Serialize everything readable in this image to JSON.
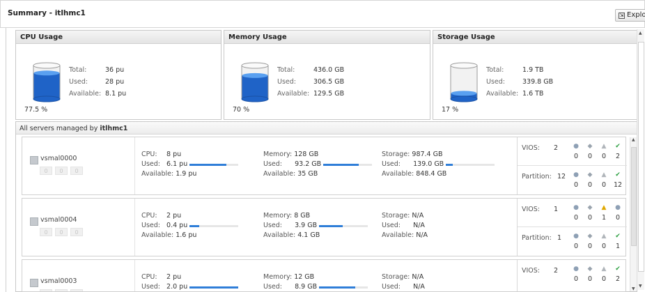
{
  "header": {
    "title": "Summary - itlhmc1",
    "explore_label": "Explore"
  },
  "usage": {
    "cpu": {
      "title": "CPU Usage",
      "total_label": "Total:",
      "total": "36 pu",
      "used_label": "Used:",
      "used": "28 pu",
      "avail_label": "Available:",
      "available": "8.1 pu",
      "percent": "77.5 %",
      "fill_fraction": 0.775
    },
    "memory": {
      "title": "Memory Usage",
      "total_label": "Total:",
      "total": "436.0 GB",
      "used_label": "Used:",
      "used": "306.5 GB",
      "avail_label": "Available:",
      "available": "129.5 GB",
      "percent": "70 %",
      "fill_fraction": 0.7
    },
    "storage": {
      "title": "Storage Usage",
      "total_label": "Total:",
      "total": "1.9 TB",
      "used_label": "Used:",
      "used": "339.8 GB",
      "avail_label": "Available:",
      "available": "1.6 TB",
      "percent": "17 %",
      "fill_fraction": 0.17
    }
  },
  "servers": {
    "header_prefix": "All servers managed by",
    "header_host": "itlhmc1",
    "rows": [
      {
        "name": "vsmal0000",
        "badges": [
          "0",
          "0",
          "0"
        ],
        "cpu_label": "CPU:",
        "cpu": "8 pu",
        "cpu_used_label": "Used:",
        "cpu_used": "6.1 pu",
        "cpu_used_fraction": 0.76,
        "cpu_avail_label": "Available:",
        "cpu_avail": "1.9 pu",
        "mem_label": "Memory:",
        "mem": "128 GB",
        "mem_used_label": "Used:",
        "mem_used": "93.2 GB",
        "mem_used_fraction": 0.73,
        "mem_avail_label": "Available:",
        "mem_avail": "35 GB",
        "sto_label": "Storage:",
        "sto": "987.4 GB",
        "sto_used_label": "Used:",
        "sto_used": "139.0 GB",
        "sto_used_fraction": 0.14,
        "sto_avail_label": "Available:",
        "sto_avail": "848.4 GB",
        "vios_label": "VIOS:",
        "vios_total": "2",
        "vios_counts": [
          "0",
          "0",
          "0",
          "2"
        ],
        "part_label": "Partition:",
        "part_total": "12",
        "part_counts": [
          "0",
          "0",
          "0",
          "12"
        ]
      },
      {
        "name": "vsmal0004",
        "badges": [
          "0",
          "0",
          "0"
        ],
        "cpu_label": "CPU:",
        "cpu": "2 pu",
        "cpu_used_label": "Used:",
        "cpu_used": "0.4 pu",
        "cpu_used_fraction": 0.2,
        "cpu_avail_label": "Available:",
        "cpu_avail": "1.6 pu",
        "mem_label": "Memory:",
        "mem": "8 GB",
        "mem_used_label": "Used:",
        "mem_used": "3.9 GB",
        "mem_used_fraction": 0.49,
        "mem_avail_label": "Available:",
        "mem_avail": "4.1 GB",
        "sto_label": "Storage:",
        "sto": "N/A",
        "sto_used_label": "Used:",
        "sto_used": "N/A",
        "sto_avail_label": "Available:",
        "sto_avail": "N/A",
        "vios_label": "VIOS:",
        "vios_total": "1",
        "vios_counts": [
          "0",
          "0",
          "1",
          "0"
        ],
        "part_label": "Partition:",
        "part_total": "1",
        "part_counts": [
          "0",
          "0",
          "0",
          "1"
        ]
      },
      {
        "name": "vsmal0003",
        "badges": [
          "0",
          "0",
          "0"
        ],
        "cpu_label": "CPU:",
        "cpu": "2 pu",
        "cpu_used_label": "Used:",
        "cpu_used": "2.0 pu",
        "cpu_used_fraction": 1.0,
        "mem_label": "Memory:",
        "mem": "12 GB",
        "mem_used_label": "Used:",
        "mem_used": "8.9 GB",
        "mem_used_fraction": 0.74,
        "sto_label": "Storage:",
        "sto": "N/A",
        "sto_used_label": "Used:",
        "sto_used": "N/A",
        "vios_label": "VIOS:",
        "vios_total": "2",
        "vios_counts": [
          "0",
          "0",
          "0",
          "2"
        ]
      }
    ]
  },
  "colors": {
    "accent": "#2f7ed8",
    "ok": "#2ea043",
    "warning": "#e0a800"
  },
  "status_icons": [
    "circle-icon",
    "diamond-icon",
    "triangle-icon",
    "check-icon"
  ]
}
